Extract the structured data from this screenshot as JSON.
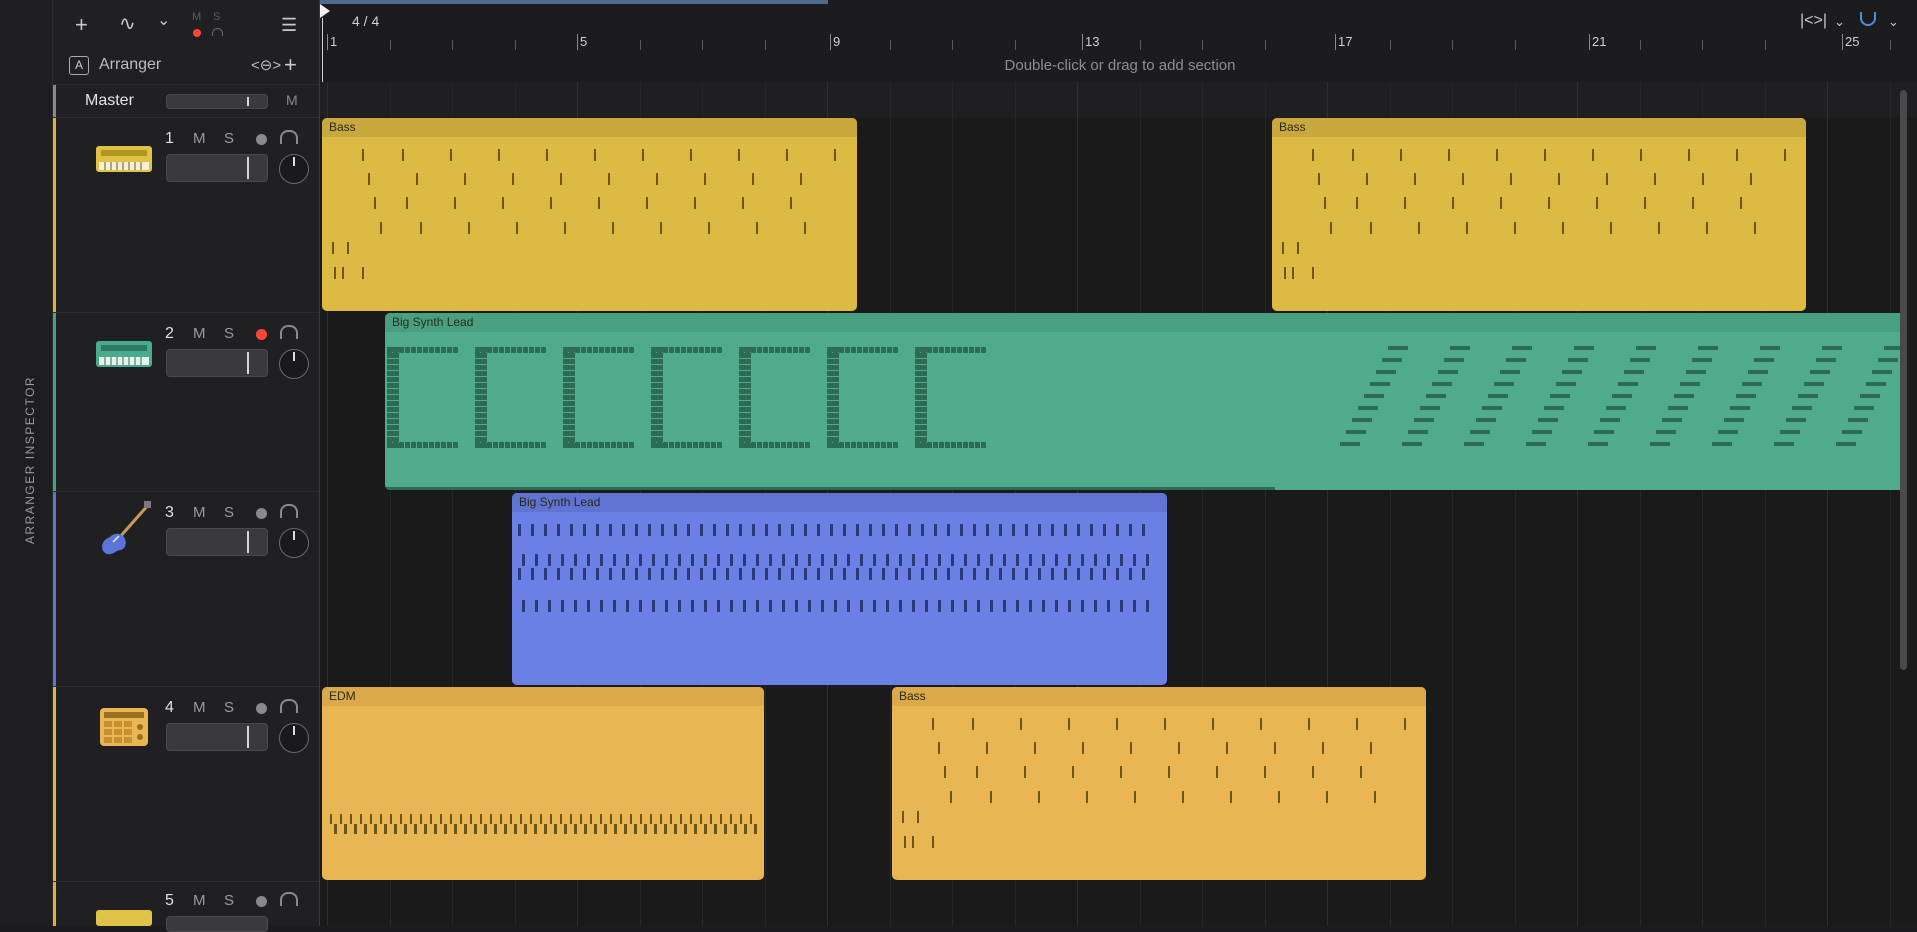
{
  "sidebar": {
    "label": "ARRANGER INSPECTOR"
  },
  "toolbar": {
    "add": "+",
    "automation": "∿",
    "chevron": "⌄",
    "m_label": "M",
    "s_label": "S",
    "filter": "☰"
  },
  "arranger": {
    "label": "Arranger"
  },
  "master": {
    "label": "Master",
    "mute": "M"
  },
  "tracks": [
    {
      "num": "1",
      "m": "M",
      "s": "S",
      "color": "#d9b23c",
      "armed": false,
      "icon": "keyboard-icon"
    },
    {
      "num": "2",
      "m": "M",
      "s": "S",
      "color": "#45a385",
      "armed": true,
      "icon": "synth-icon"
    },
    {
      "num": "3",
      "m": "M",
      "s": "S",
      "color": "#5b74d6",
      "armed": false,
      "icon": "bass-guitar-icon"
    },
    {
      "num": "4",
      "m": "M",
      "s": "S",
      "color": "#e2b24c",
      "armed": false,
      "icon": "drum-pad-icon"
    },
    {
      "num": "5",
      "m": "M",
      "s": "S",
      "color": "#d9b23c",
      "armed": false,
      "icon": "keyboard-icon"
    }
  ],
  "timeline": {
    "time_signature": "4 / 4",
    "bars": [
      "1",
      "5",
      "9",
      "13",
      "17",
      "21",
      "25"
    ],
    "hint": "Double-click or drag to add section"
  },
  "regions": [
    {
      "name": "Bass",
      "track": 1,
      "color": "#dcba44",
      "head": "#c9a83e"
    },
    {
      "name": "Bass",
      "track": 1,
      "color": "#dcba44",
      "head": "#c9a83e"
    },
    {
      "name": "Big Synth Lead",
      "track": 2,
      "color": "#4fab8c",
      "head": "#48a081"
    },
    {
      "name": "Big Synth Lead",
      "track": 3,
      "color": "#6a80e4",
      "head": "#5f73d3"
    },
    {
      "name": "EDM",
      "track": 4,
      "color": "#e8b652",
      "head": "#dba94a"
    },
    {
      "name": "Bass",
      "track": 4,
      "color": "#e8b652",
      "head": "#dba94a"
    }
  ],
  "colors": {
    "accent_blue": "#4a90e2",
    "record_red": "#ff453a"
  }
}
